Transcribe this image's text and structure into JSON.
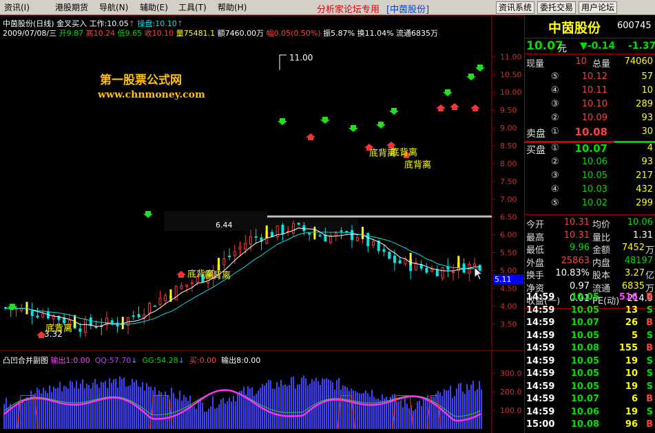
{
  "menu": {
    "items": [
      "资讯(I)",
      "港股期货",
      "导航(N)",
      "辅助(E)",
      "工具(T)",
      "帮助(H)"
    ],
    "promo": "分析家论坛专用",
    "promo_site": "[中茵股份]",
    "buttons": [
      "资讯系统",
      "委托交易",
      "用户论坛"
    ]
  },
  "chart_header": {
    "name": "中茵股份(日线)",
    "indicator": "金叉买入",
    "work_label": "工作:10.05",
    "work_arrow": "↑",
    "operate_label": "操盘:10.10",
    "operate_arrow": "↑",
    "date": "2009/07/08/三",
    "open": "开9.87",
    "high": "高10.24",
    "low": "低9.65",
    "close": "收10.10",
    "volume": "量75481.1",
    "amount": "额7460.00万",
    "change": "幅0.05(0.50%)",
    "amplitude": "振5.87%",
    "turnover": "换11.04%",
    "float": "流通6835万"
  },
  "watermark": {
    "line1": "第一股票公式网",
    "line2": "www.chnmoney.com"
  },
  "price_axis": [
    "11.00",
    "10.50",
    "10.00",
    "9.50",
    "9.00",
    "8.50",
    "8.00",
    "7.50",
    "7.00",
    "6.50",
    "6.00",
    "5.50",
    "5.00",
    "4.50",
    "4.00",
    "3.50"
  ],
  "price_marker": "5.11",
  "annotations": {
    "high": "11.00",
    "low": "3.32",
    "mid": "6.44",
    "divergence": [
      "底背离",
      "底背离",
      "底背离",
      "底背离",
      "底背离",
      "底背离"
    ]
  },
  "sub_header": {
    "name": "凸凹合并副图",
    "out1": "输出1:0.00",
    "qq": "QQ:57.70",
    "qq_arrow": "↓",
    "gg": "GG:54.28",
    "gg_arrow": "↓",
    "buy": "买:0.00",
    "out8": "输出8:0.00"
  },
  "sub_axis": [
    "300.0",
    "200.0",
    "100.0"
  ],
  "stock": {
    "name": "中茵股份",
    "code": "600745",
    "price": "10.07",
    "unit": "元",
    "change": "▼-0.14",
    "change2": "-1.37"
  },
  "volume_now": {
    "label1": "现量",
    "value1": "10",
    "label2": "总量",
    "value2": "74060"
  },
  "sell_orders": [
    {
      "level": "⑤",
      "price": "10.12",
      "vol": "57"
    },
    {
      "level": "④",
      "price": "10.11",
      "vol": "10"
    },
    {
      "level": "③",
      "price": "10.10",
      "vol": "289"
    },
    {
      "level": "②",
      "price": "10.09",
      "vol": "93"
    },
    {
      "label": "卖盘",
      "level": "①",
      "price": "10.08",
      "vol": "30"
    }
  ],
  "buy_orders": [
    {
      "label": "买盘",
      "level": "①",
      "price": "10.07",
      "vol": "4"
    },
    {
      "level": "②",
      "price": "10.06",
      "vol": "93"
    },
    {
      "level": "③",
      "price": "10.05",
      "vol": "217"
    },
    {
      "level": "④",
      "price": "10.03",
      "vol": "432"
    },
    {
      "level": "⑤",
      "price": "10.02",
      "vol": "299"
    }
  ],
  "stats": [
    {
      "l1": "今开",
      "v1": "10.31",
      "l2": "均价",
      "v2": "10.06"
    },
    {
      "l1": "最高",
      "v1": "10.31",
      "l2": "量比",
      "v2": "1.31"
    },
    {
      "l1": "最低",
      "v1": "9.96",
      "l2": "金额",
      "v2": "7452",
      "u2": "万"
    },
    {
      "l1": "外盘",
      "v1": "25863",
      "l2": "内盘",
      "v2": "48197"
    },
    {
      "l1": "换手",
      "v1": "10.83%",
      "l2": "股本",
      "v2": "3.27",
      "u2": "亿"
    },
    {
      "l1": "净资",
      "v1": "0.97",
      "l2": "流通",
      "v2": "6835",
      "u2": "万"
    },
    {
      "l1": "收益(一)",
      "v1": "0.01",
      "l2": "PE(动)",
      "v2": "214.9"
    }
  ],
  "ticks": [
    {
      "time": "14:59",
      "price": "10.05",
      "vol": "516",
      "side": "B"
    },
    {
      "time": "14:59",
      "price": "10.05",
      "vol": "13",
      "side": "S"
    },
    {
      "time": "14:59",
      "price": "10.07",
      "vol": "26",
      "side": "B"
    },
    {
      "time": "14:59",
      "price": "10.05",
      "vol": "5",
      "side": "S"
    },
    {
      "time": "14:59",
      "price": "10.08",
      "vol": "155",
      "side": "B"
    },
    {
      "time": "14:59",
      "price": "10.05",
      "vol": "19",
      "side": "S"
    },
    {
      "time": "14:59",
      "price": "10.05",
      "vol": "10",
      "side": "S"
    },
    {
      "time": "14:59",
      "price": "10.05",
      "vol": "19",
      "side": "S"
    },
    {
      "time": "14:59",
      "price": "10.07",
      "vol": "6",
      "side": "B"
    },
    {
      "time": "14:59",
      "price": "10.06",
      "vol": "19",
      "side": "S"
    },
    {
      "time": "15:00",
      "price": "10.08",
      "vol": "96",
      "side": "B"
    }
  ],
  "colors": {
    "up": "#ff3c3c",
    "down": "#00e5e5",
    "ma": "#ffffff",
    "ma2": "#00e5e5",
    "menu_bg": "#d4d0c8",
    "accent": "#ffff00",
    "sub_bar": "#4040ff"
  }
}
